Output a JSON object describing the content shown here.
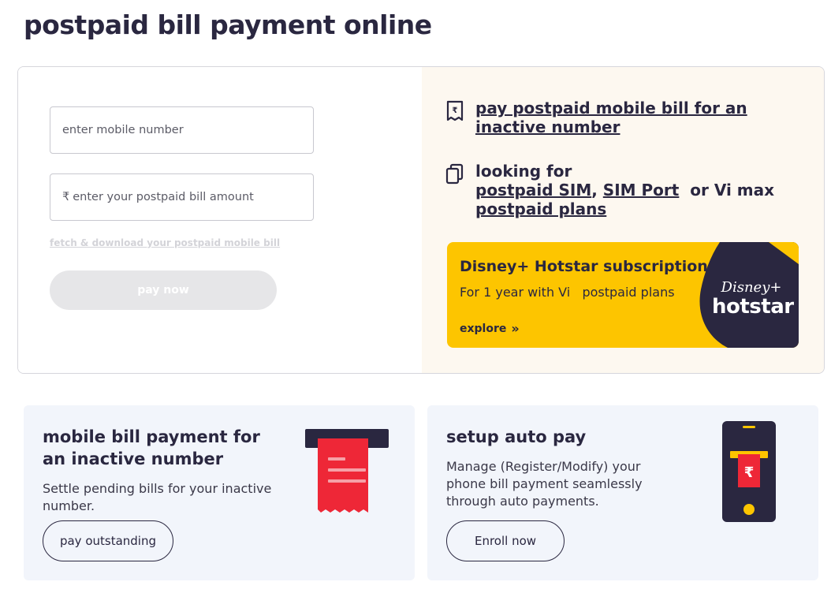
{
  "page": {
    "title": "postpaid bill payment online"
  },
  "form": {
    "mobile_placeholder": "enter mobile number",
    "amount_prefix": "₹",
    "amount_placeholder": "enter your postpaid bill amount",
    "fetch_link": "fetch & download your postpaid mobile bill",
    "pay_button": "pay now"
  },
  "info": {
    "inactive_link": "pay postpaid mobile bill for an inactive number",
    "looking_for": "looking for",
    "postpaid_sim": "postpaid SIM",
    "comma": ",",
    "sim_port": "SIM Port",
    "or_vi_max": "or Vi max",
    "postpaid_plans": "postpaid plans"
  },
  "promo": {
    "title": "Disney+ Hotstar subscription",
    "subtitle": "For 1 year with Vi   postpaid plans",
    "explore": "explore",
    "explore_icon": "double-chevron-right-icon",
    "logo_top": "Disney+",
    "logo_bottom": "hotstar",
    "bg_color": "#fdc500",
    "blob_color": "#2a2740"
  },
  "cards": {
    "inactive": {
      "title": "mobile bill payment for an inactive number",
      "desc": "Settle pending bills for your inactive number.",
      "button": "pay outstanding",
      "icon": "receipt-icon"
    },
    "autopay": {
      "title": "setup auto pay",
      "desc": "Manage (Register/Modify) your phone bill payment seamlessly through auto payments.",
      "button": "Enroll now",
      "icon": "phone-receipt-icon"
    }
  },
  "colors": {
    "text": "#2a2740",
    "accent_red": "#ee2737",
    "right_pane_bg": "#fdf8f0",
    "card_bg": "#f2f5fb",
    "yellow": "#fdc500"
  }
}
